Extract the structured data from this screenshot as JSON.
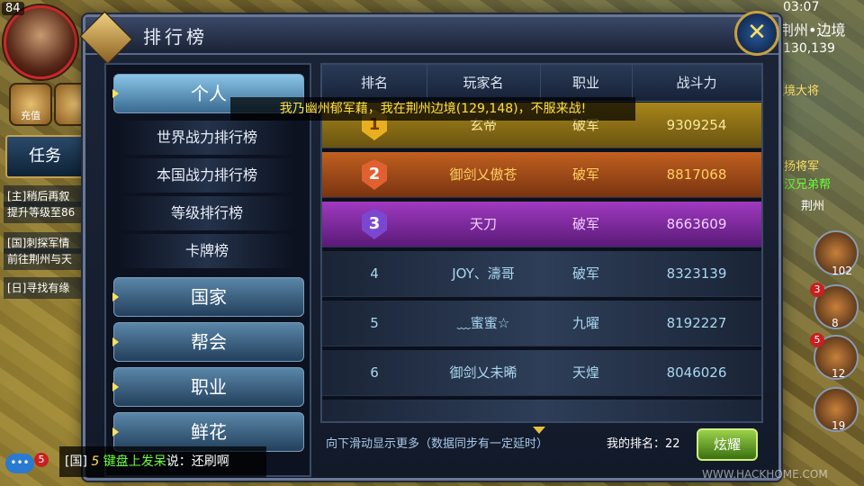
{
  "hud": {
    "level": "84",
    "time": "03:07",
    "location": "荆州•边境",
    "coords": "130,139",
    "recharge_label": "充值",
    "task_label": "任务",
    "quests": [
      "[主]稍后再叙",
      "提升等级至86",
      "[国]刺探军情",
      "前往荆州与天",
      "[日]寻找有缘"
    ],
    "right_texts": [
      "边境大将",
      "鹰扬将军",
      "蜀汉兄弟帮",
      "荆州"
    ],
    "right_counts": [
      "102",
      "8",
      "12",
      "19"
    ],
    "right_badges": [
      "3",
      "5"
    ]
  },
  "panel": {
    "title": "排行榜",
    "close_label": "✕"
  },
  "menu": {
    "categories": [
      {
        "label": "个人",
        "active": true
      },
      {
        "label": "国家"
      },
      {
        "label": "帮会"
      },
      {
        "label": "职业"
      },
      {
        "label": "鲜花"
      }
    ],
    "subitems": [
      "世界战力排行榜",
      "本国战力排行榜",
      "等级排行榜",
      "卡牌榜"
    ]
  },
  "table": {
    "headers": [
      "排名",
      "玩家名",
      "职业",
      "战斗力"
    ],
    "rows": [
      {
        "rank": "1",
        "name": "玄帝",
        "job": "破军",
        "power": "9309254"
      },
      {
        "rank": "2",
        "name": "御剑乂傲苍",
        "job": "破军",
        "power": "8817068"
      },
      {
        "rank": "3",
        "name": "天刀",
        "job": "破军",
        "power": "8663609"
      },
      {
        "rank": "4",
        "name": "JOY、濤哥",
        "job": "破军",
        "power": "8323139"
      },
      {
        "rank": "5",
        "name": "﹏蜜蜜☆",
        "job": "九曜",
        "power": "8192227"
      },
      {
        "rank": "6",
        "name": "御剑乂未晞",
        "job": "天煌",
        "power": "8046026"
      }
    ]
  },
  "broadcast": "我乃幽州郁军藉，我在荆州边境(129,148)，不服来战!",
  "footer": {
    "hint": "向下滑动显示更多（数据同步有一定延时）",
    "my_rank_label": "我的排名：",
    "my_rank_value": "22",
    "show_button": "炫耀"
  },
  "chat": {
    "channel": "[国]",
    "vip": "5",
    "name": "键盘上发呆",
    "said": "说：",
    "message": "还刷啊",
    "badge": "5"
  },
  "watermark": "WWW.HACKHOME.COM",
  "colors": {
    "rank1": "#a8861a",
    "rank2": "#c06020",
    "rank3": "#a03ac0",
    "accent": "#ffe060"
  }
}
